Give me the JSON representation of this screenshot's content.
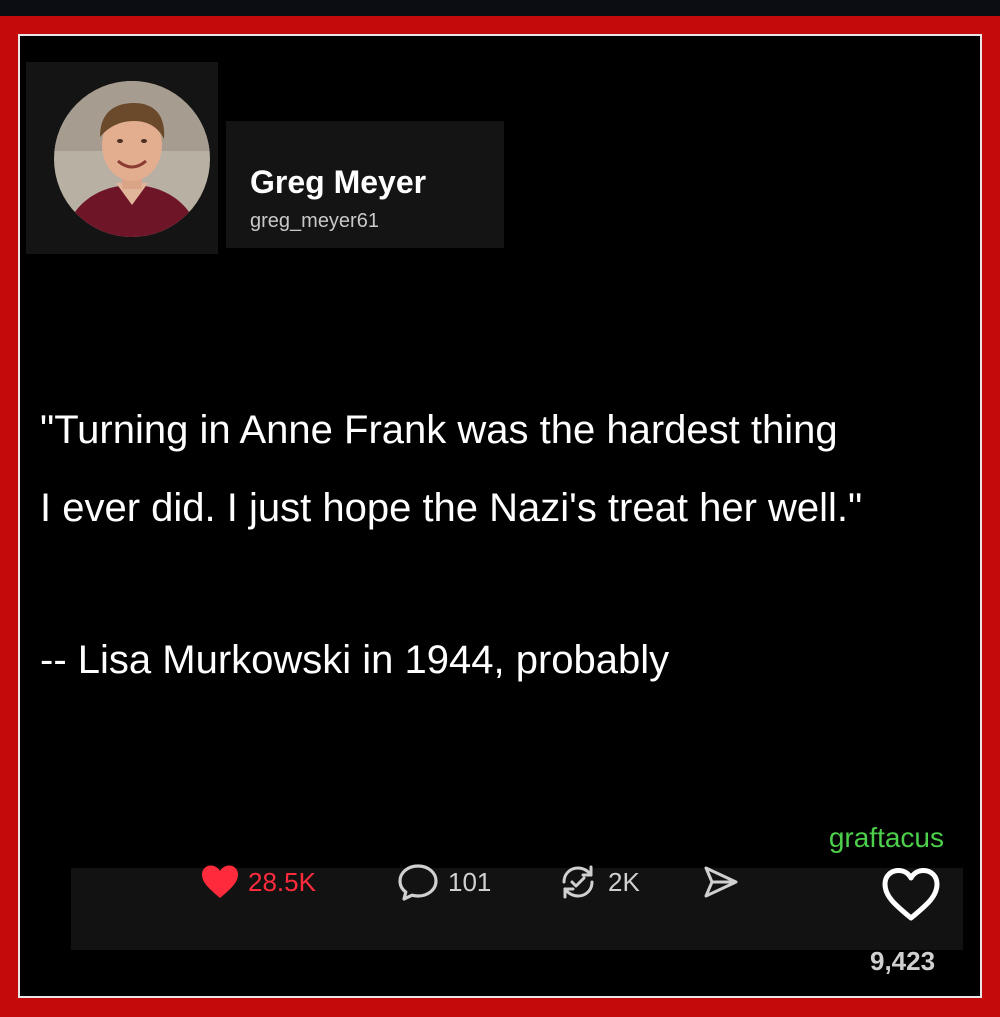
{
  "post": {
    "author_name": "Greg Meyer",
    "author_handle": "greg_meyer61",
    "quote_line_1": "\"Turning in Anne Frank was the hardest thing",
    "quote_line_2": "I ever did. I just hope the Nazi's treat her well.\"",
    "attribution": "-- Lisa Murkowski in 1944, probably",
    "watermark": "graftacus"
  },
  "actions": {
    "likes": "28.5K",
    "replies": "101",
    "reposts": "2K"
  },
  "overlay": {
    "view_count": "9,423"
  },
  "icons": {
    "like": "heart-filled-icon",
    "reply": "speech-bubble-icon",
    "repost": "repost-arrows-icon",
    "share": "send-icon",
    "side_like": "heart-outline-icon"
  },
  "colors": {
    "frame": "#c40a0a",
    "like_active": "#ff2b3d",
    "watermark": "#4ccf4a"
  }
}
